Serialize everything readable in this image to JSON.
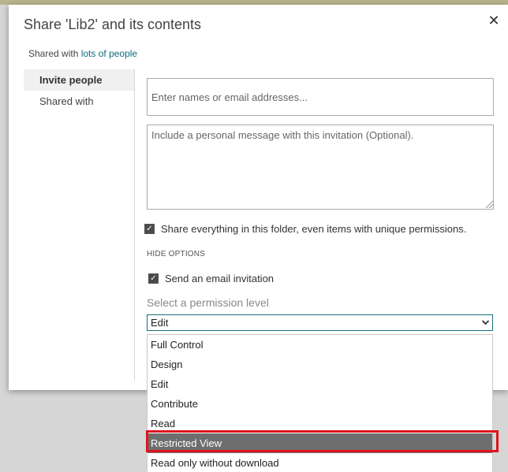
{
  "dialog": {
    "title": "Share 'Lib2' and its contents",
    "close_glyph": "✕",
    "shared_prefix": "Shared with",
    "shared_link": "lots of people"
  },
  "nav": {
    "items": [
      {
        "label": "Invite people",
        "active": true
      },
      {
        "label": "Shared with",
        "active": false
      }
    ]
  },
  "form": {
    "names_placeholder": "Enter names or email addresses...",
    "message_placeholder": "Include a personal message with this invitation (Optional).",
    "share_all_label": "Share everything in this folder, even items with unique permissions.",
    "share_all_checked": true,
    "hide_options": "HIDE OPTIONS",
    "send_email_label": "Send an email invitation",
    "send_email_checked": true,
    "permission_label": "Select a permission level",
    "permission_value": "Edit"
  },
  "dropdown": {
    "options": [
      "Full Control",
      "Design",
      "Edit",
      "Contribute",
      "Read",
      "Restricted View",
      "Read only without download"
    ],
    "highlighted": "Restricted View"
  },
  "colors": {
    "link": "#0a6b7c",
    "select_border": "#1a6f7f",
    "highlight": "#e0141e",
    "selected_option_bg": "#6e6e6e"
  }
}
